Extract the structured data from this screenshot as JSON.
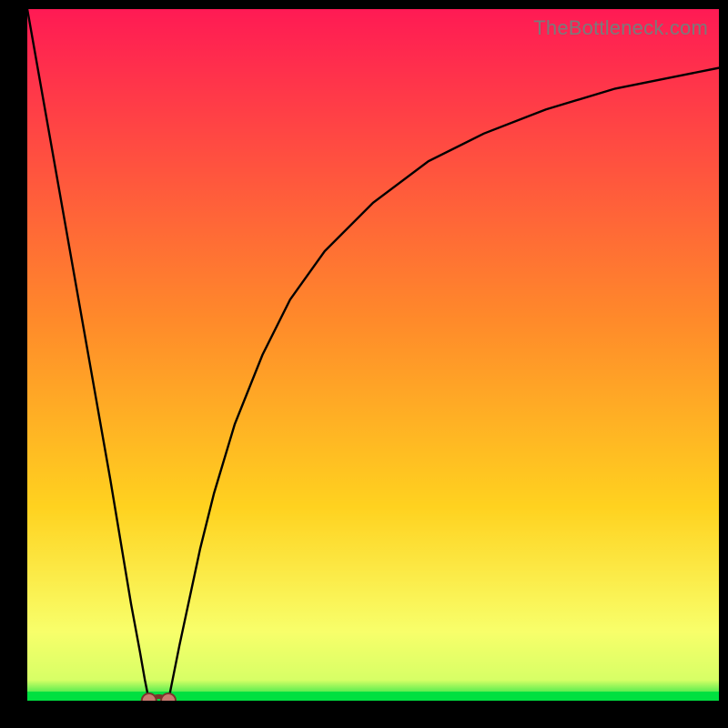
{
  "watermark": "TheBottleneck.com",
  "colors": {
    "frame": "#000000",
    "grad_top": "#ff1a54",
    "grad_mid1": "#ff6a2a",
    "grad_mid2": "#ffd21f",
    "grad_band": "#f8ff6a",
    "grad_green": "#00e040",
    "curve": "#000000",
    "marker_fill": "#c97a70",
    "marker_stroke": "#7d342c"
  },
  "chart_data": {
    "type": "line",
    "title": "",
    "xlabel": "",
    "ylabel": "",
    "xlim": [
      0,
      100
    ],
    "ylim": [
      0,
      100
    ],
    "series": [
      {
        "name": "left-branch",
        "x": [
          0,
          3,
          6,
          9,
          12,
          13.5,
          15,
          16.3,
          17,
          17.6
        ],
        "values": [
          100,
          83,
          66,
          49,
          32,
          23,
          14,
          7,
          3,
          0
        ]
      },
      {
        "name": "right-branch",
        "x": [
          20.4,
          21,
          22,
          23.5,
          25,
          27,
          30,
          34,
          38,
          43,
          50,
          58,
          66,
          75,
          85,
          95,
          100
        ],
        "values": [
          0,
          3,
          8,
          15,
          22,
          30,
          40,
          50,
          58,
          65,
          72,
          78,
          82,
          85.5,
          88.5,
          90.5,
          91.5
        ]
      }
    ],
    "markers": {
      "name": "bottom-dots",
      "points": [
        {
          "x": 17.6,
          "y": 0
        },
        {
          "x": 20.4,
          "y": 0
        }
      ],
      "connector_y": 1.2
    }
  }
}
